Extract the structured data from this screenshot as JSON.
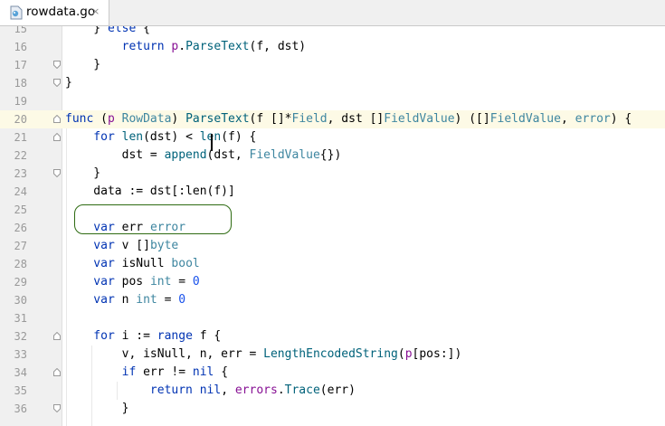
{
  "tab": {
    "filename": "rowdata.go",
    "close_icon": "×"
  },
  "colors": {
    "keyword": "#0033b3",
    "type": "#3e86a0",
    "function": "#00627a",
    "number": "#1750eb",
    "highlight_box": "#2e6b12"
  },
  "lines": [
    {
      "n": "15",
      "t": "    } else {"
    },
    {
      "n": "16",
      "t": "        return p.ParseText(f, dst)"
    },
    {
      "n": "17",
      "t": "    }"
    },
    {
      "n": "18",
      "t": "}"
    },
    {
      "n": "19",
      "t": ""
    },
    {
      "n": "20",
      "t": "func (p RowData) ParseText(f []*Field, dst []FieldValue) ([]FieldValue, error) {"
    },
    {
      "n": "21",
      "t": "    for len(dst) < len(f) {"
    },
    {
      "n": "22",
      "t": "        dst = append(dst, FieldValue{})"
    },
    {
      "n": "23",
      "t": "    }"
    },
    {
      "n": "24",
      "t": "    data := dst[:len(f)]"
    },
    {
      "n": "25",
      "t": ""
    },
    {
      "n": "26",
      "t": "    var err error"
    },
    {
      "n": "27",
      "t": "    var v []byte"
    },
    {
      "n": "28",
      "t": "    var isNull bool"
    },
    {
      "n": "29",
      "t": "    var pos int = 0"
    },
    {
      "n": "30",
      "t": "    var n int = 0"
    },
    {
      "n": "31",
      "t": ""
    },
    {
      "n": "32",
      "t": "    for i := range f {"
    },
    {
      "n": "33",
      "t": "        v, isNull, n, err = LengthEncodedString(p[pos:])"
    },
    {
      "n": "34",
      "t": "        if err != nil {"
    },
    {
      "n": "35",
      "t": "            return nil, errors.Trace(err)"
    },
    {
      "n": "36",
      "t": "        }"
    }
  ]
}
